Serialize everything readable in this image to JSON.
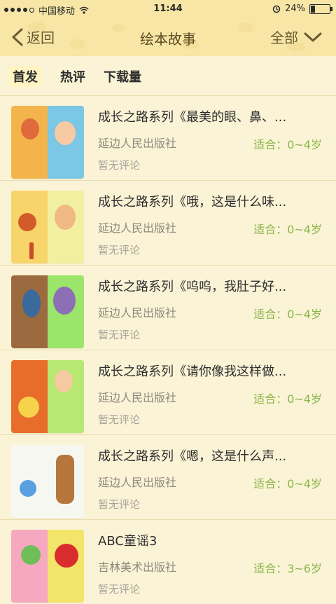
{
  "status_bar": {
    "carrier": "中国移动",
    "time": "11:44",
    "battery": "24%",
    "battery_level": 0.24
  },
  "nav": {
    "back_label": "返回",
    "title": "绘本故事",
    "filter_label": "全部"
  },
  "tabs": [
    {
      "label": "首发",
      "active": true
    },
    {
      "label": "热评",
      "active": false
    },
    {
      "label": "下载量",
      "active": false
    }
  ],
  "books": [
    {
      "title": "成长之路系列《最美的眼、鼻、...",
      "publisher": "延边人民出版社",
      "age": "适合：0~4岁",
      "reviews": "暂无评论",
      "colors": {
        "left": "#f2b44b",
        "right": "#7cc6e6",
        "accent": "#e06a3b"
      }
    },
    {
      "title": "成长之路系列《哦，这是什么味...",
      "publisher": "延边人民出版社",
      "age": "适合：0~4岁",
      "reviews": "暂无评论",
      "colors": {
        "left": "#f7d56a",
        "right": "#f2f0a0",
        "accent": "#d35b2b"
      }
    },
    {
      "title": "成长之路系列《呜呜，我肚子好...",
      "publisher": "延边人民出版社",
      "age": "适合：0~4岁",
      "reviews": "暂无评论",
      "colors": {
        "left": "#9c6a3f",
        "right": "#9be56b",
        "accent": "#3a6a9c"
      }
    },
    {
      "title": "成长之路系列《请你像我这样做...",
      "publisher": "延边人民出版社",
      "age": "适合：0~4岁",
      "reviews": "暂无评论",
      "colors": {
        "left": "#e86d2a",
        "right": "#b6e872",
        "accent": "#f6d34a"
      }
    },
    {
      "title": "成长之路系列《嗯，这是什么声...",
      "publisher": "延边人民出版社",
      "age": "适合：0~4岁",
      "reviews": "暂无评论",
      "colors": {
        "left": "#f7f7f2",
        "right": "#f7f7f2",
        "accent": "#b6763b"
      }
    },
    {
      "title": "ABC童谣3",
      "publisher": "吉林美术出版社",
      "age": "适合：3~6岁",
      "reviews": "暂无评论",
      "colors": {
        "left": "#f6a8c0",
        "right": "#f2e56a",
        "accent": "#d92c2c"
      }
    }
  ]
}
